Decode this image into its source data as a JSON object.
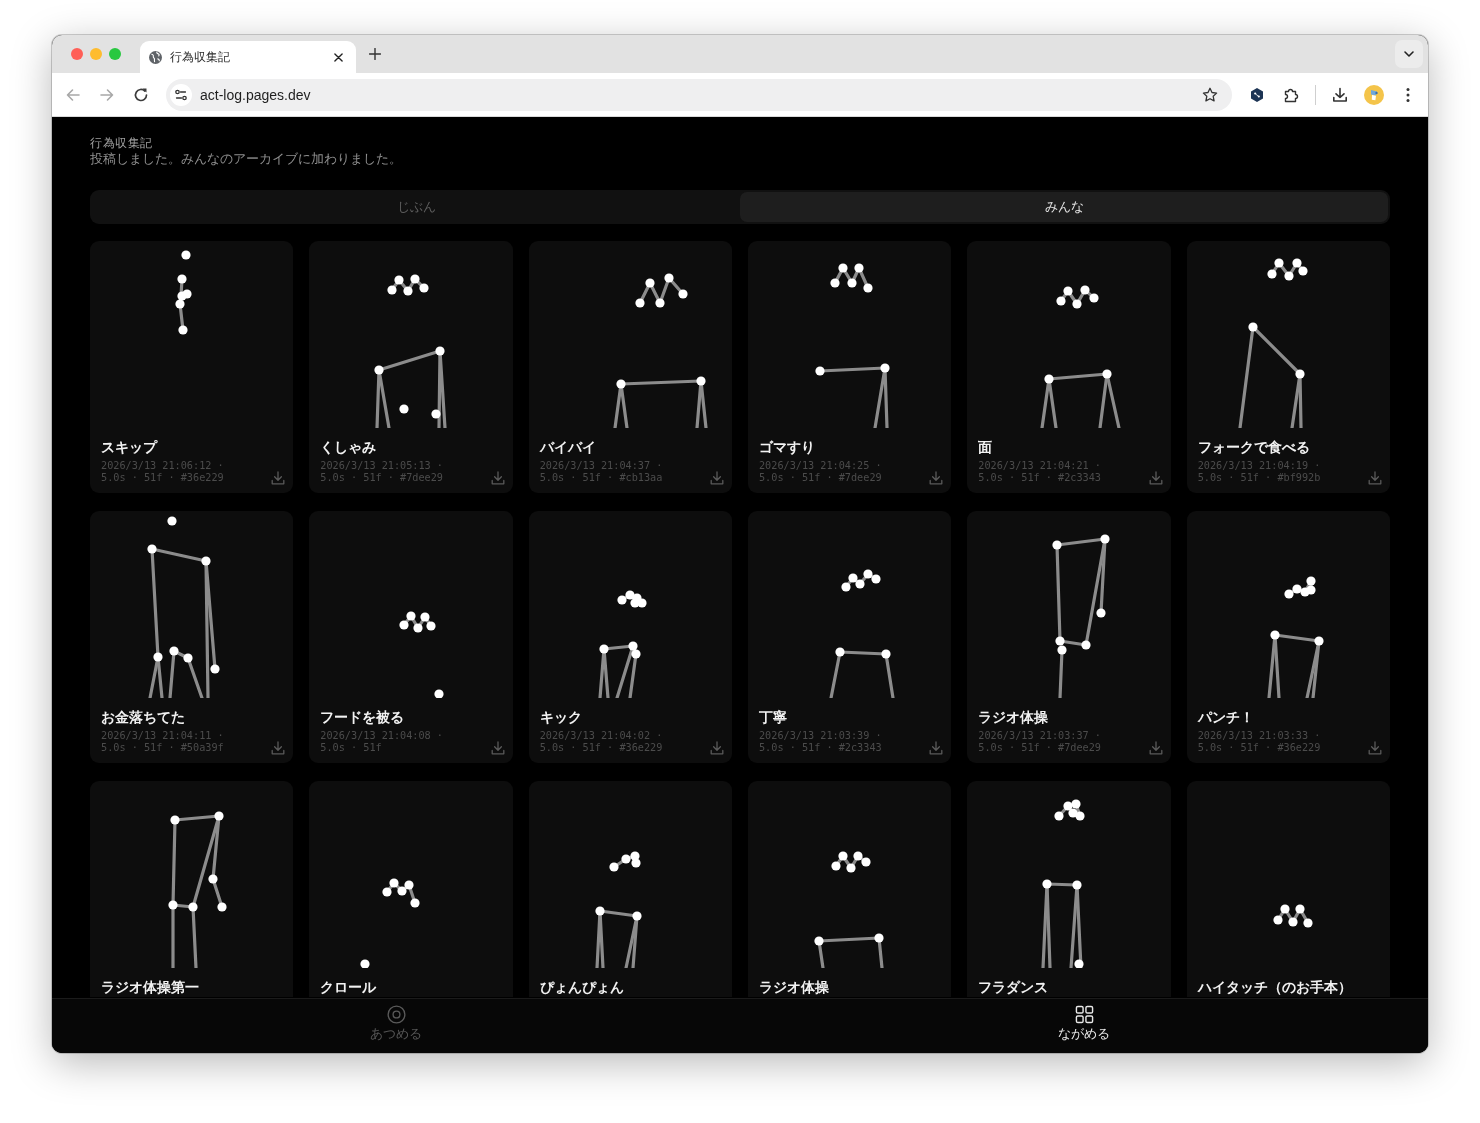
{
  "browser": {
    "tab": {
      "title": "行為収集記"
    },
    "nav": [
      {
        "kind": "back",
        "disabled": true
      },
      {
        "kind": "forward",
        "disabled": true
      },
      {
        "kind": "reload",
        "disabled": false
      }
    ],
    "address": {
      "url": "act-log.pages.dev"
    }
  },
  "header": {
    "title": "行為収集記",
    "message": "投稿しました。みんなのアーカイブに加わりました。"
  },
  "tabs": [
    {
      "label": "じぶん",
      "selected": false
    },
    {
      "label": "みんな",
      "selected": true
    }
  ],
  "cards": [
    {
      "title": "スキップ",
      "meta_lines": [
        "2026/3/13 21:06:12 ·",
        "5.0s · 51f · #36e229"
      ]
    },
    {
      "title": "くしゃみ",
      "meta_lines": [
        "2026/3/13 21:05:13 ·",
        "5.0s · 51f · #7dee29"
      ]
    },
    {
      "title": "バイバイ",
      "meta_lines": [
        "2026/3/13 21:04:37 ·",
        "5.0s · 51f · #cb13aa"
      ]
    },
    {
      "title": "ゴマすり",
      "meta_lines": [
        "2026/3/13 21:04:25 ·",
        "5.0s · 51f · #7dee29"
      ]
    },
    {
      "title": "面",
      "meta_lines": [
        "2026/3/13 21:04:21 ·",
        "5.0s · 51f · #2c3343"
      ]
    },
    {
      "title": "フォークで食べる",
      "meta_lines": [
        "2026/3/13 21:04:19 ·",
        "5.0s · 51f · #bf992b"
      ]
    },
    {
      "title": "お金落ちてた",
      "meta_lines": [
        "2026/3/13 21:04:11 ·",
        "5.0s · 51f · #50a39f"
      ]
    },
    {
      "title": "フードを被る",
      "meta_lines": [
        "2026/3/13 21:04:08 ·",
        "5.0s · 51f"
      ]
    },
    {
      "title": "キック",
      "meta_lines": [
        "2026/3/13 21:04:02 ·",
        "5.0s · 51f · #36e229"
      ]
    },
    {
      "title": "丁寧",
      "meta_lines": [
        "2026/3/13 21:03:39 ·",
        "5.0s · 51f · #2c3343"
      ]
    },
    {
      "title": "ラジオ体操",
      "meta_lines": [
        "2026/3/13 21:03:37 ·",
        "5.0s · 51f · #7dee29"
      ]
    },
    {
      "title": "パンチ！",
      "meta_lines": [
        "2026/3/13 21:03:33 ·",
        "5.0s · 51f · #36e229"
      ]
    },
    {
      "title": "ラジオ体操第一"
    },
    {
      "title": "クロール"
    },
    {
      "title": "ぴょんぴょん"
    },
    {
      "title": "ラジオ体操"
    },
    {
      "title": "フラダンス"
    },
    {
      "title": "ハイタッチ（のお手本）"
    }
  ],
  "bottom_nav": [
    {
      "kind": "collect",
      "label": "あつめる",
      "selected": false
    },
    {
      "kind": "browse",
      "label": "ながめる",
      "selected": true
    }
  ]
}
